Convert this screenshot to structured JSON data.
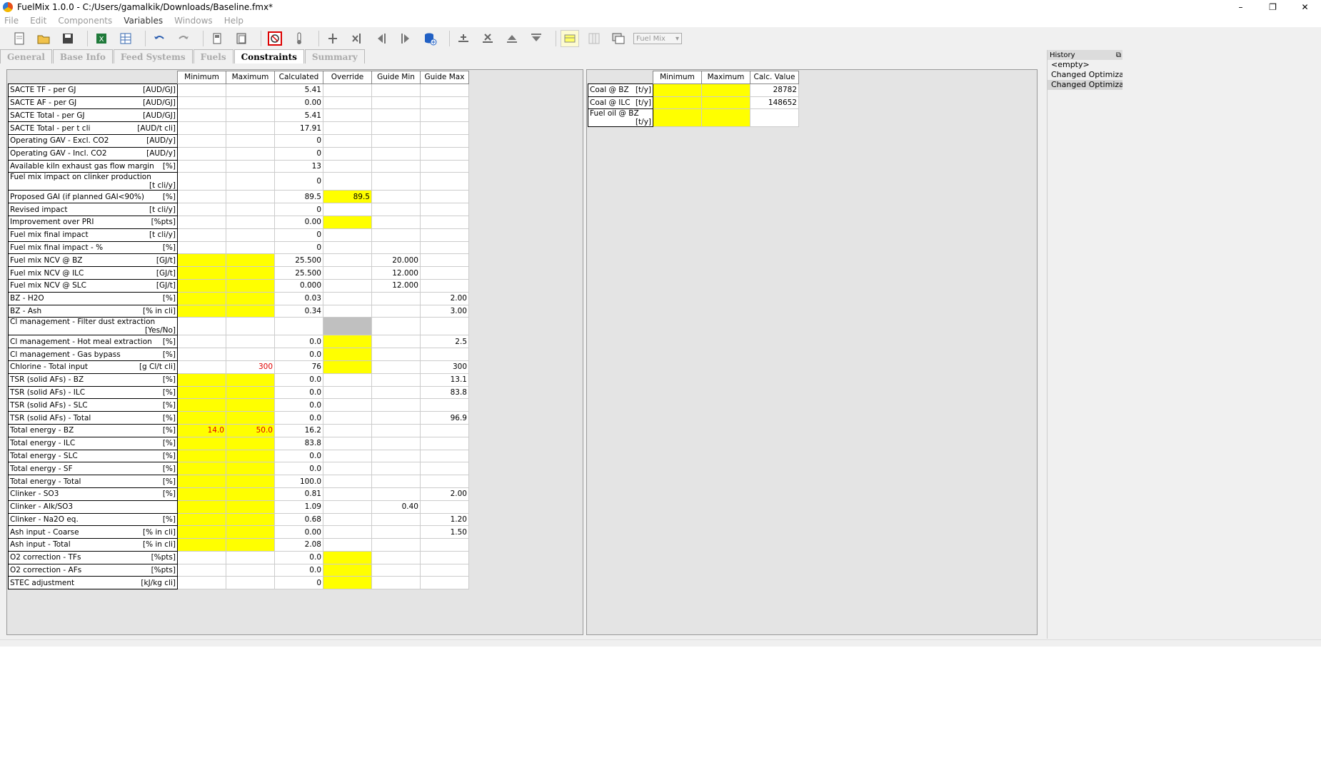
{
  "window": {
    "title": "FuelMix 1.0.0 - C:/Users/gamalkik/Downloads/Baseline.fmx*",
    "minimize": "–",
    "restore": "❐",
    "close": "✕"
  },
  "menu": [
    "File",
    "Edit",
    "Components",
    "Variables",
    "Windows",
    "Help"
  ],
  "toolbar": {
    "combo_value": "Fuel Mix",
    "combo_arrow": "▾"
  },
  "tabs": [
    "General",
    "Base Info",
    "Feed Systems",
    "Fuels",
    "Constraints",
    "Summary"
  ],
  "active_tab": "Constraints",
  "constraints": {
    "headers": [
      "Minimum",
      "Maximum",
      "Calculated",
      "Override",
      "Guide Min",
      "Guide Max"
    ],
    "rows": [
      {
        "name": "SACTE TF - per GJ",
        "unit": "[AUD/GJ]",
        "cells": [
          "",
          "",
          "5.41",
          "",
          "",
          ""
        ],
        "colors": [
          "",
          "",
          "",
          "",
          "",
          ""
        ]
      },
      {
        "name": "SACTE AF - per GJ",
        "unit": "[AUD/GJ]",
        "cells": [
          "",
          "",
          "0.00",
          "",
          "",
          ""
        ],
        "colors": [
          "",
          "",
          "",
          "",
          "",
          ""
        ]
      },
      {
        "name": "SACTE Total - per GJ",
        "unit": "[AUD/GJ]",
        "cells": [
          "",
          "",
          "5.41",
          "",
          "",
          ""
        ],
        "colors": [
          "",
          "",
          "",
          "",
          "",
          ""
        ]
      },
      {
        "name": "SACTE Total - per t cli",
        "unit": "[AUD/t cli]",
        "cells": [
          "",
          "",
          "17.91",
          "",
          "",
          ""
        ],
        "colors": [
          "",
          "",
          "",
          "",
          "",
          ""
        ]
      },
      {
        "name": "Operating GAV - Excl. CO2",
        "unit": "[AUD/y]",
        "cells": [
          "",
          "",
          "0",
          "",
          "",
          ""
        ],
        "colors": [
          "",
          "",
          "",
          "",
          "",
          ""
        ]
      },
      {
        "name": "Operating GAV - Incl. CO2",
        "unit": "[AUD/y]",
        "cells": [
          "",
          "",
          "0",
          "",
          "",
          ""
        ],
        "colors": [
          "",
          "",
          "",
          "",
          "",
          ""
        ]
      },
      {
        "name": "Available kiln exhaust gas flow margin",
        "unit": "[%]",
        "cells": [
          "",
          "",
          "13",
          "",
          "",
          ""
        ],
        "colors": [
          "",
          "",
          "",
          "",
          "",
          ""
        ]
      },
      {
        "name": "Fuel mix impact on clinker production",
        "unit": "[t cli/y]",
        "cells": [
          "",
          "",
          "0",
          "",
          "",
          ""
        ],
        "colors": [
          "",
          "",
          "",
          "",
          "",
          ""
        ]
      },
      {
        "name": "Proposed GAI (if planned GAI<90%)",
        "unit": "[%]",
        "cells": [
          "",
          "",
          "89.5",
          "89.5",
          "",
          ""
        ],
        "colors": [
          "",
          "",
          "",
          "y",
          "",
          ""
        ]
      },
      {
        "name": "Revised impact",
        "unit": "[t cli/y]",
        "cells": [
          "",
          "",
          "0",
          "",
          "",
          ""
        ],
        "colors": [
          "",
          "",
          "",
          "",
          "",
          ""
        ]
      },
      {
        "name": "Improvement over PRI",
        "unit": "[%pts]",
        "cells": [
          "",
          "",
          "0.00",
          "",
          "",
          ""
        ],
        "colors": [
          "",
          "",
          "",
          "y",
          "",
          ""
        ]
      },
      {
        "name": "Fuel mix final impact",
        "unit": "[t cli/y]",
        "cells": [
          "",
          "",
          "0",
          "",
          "",
          ""
        ],
        "colors": [
          "",
          "",
          "",
          "",
          "",
          ""
        ]
      },
      {
        "name": "Fuel mix final impact - %",
        "unit": "[%]",
        "cells": [
          "",
          "",
          "0",
          "",
          "",
          ""
        ],
        "colors": [
          "",
          "",
          "",
          "",
          "",
          ""
        ]
      },
      {
        "name": "Fuel mix NCV @ BZ",
        "unit": "[GJ/t]",
        "cells": [
          "",
          "",
          "25.500",
          "",
          "20.000",
          ""
        ],
        "colors": [
          "y",
          "y",
          "",
          "",
          "",
          ""
        ]
      },
      {
        "name": "Fuel mix NCV @ ILC",
        "unit": "[GJ/t]",
        "cells": [
          "",
          "",
          "25.500",
          "",
          "12.000",
          ""
        ],
        "colors": [
          "y",
          "y",
          "",
          "",
          "",
          ""
        ]
      },
      {
        "name": "Fuel mix NCV @ SLC",
        "unit": "[GJ/t]",
        "cells": [
          "",
          "",
          "0.000",
          "",
          "12.000",
          ""
        ],
        "colors": [
          "y",
          "y",
          "",
          "",
          "",
          ""
        ]
      },
      {
        "name": "BZ - H2O",
        "unit": "[%]",
        "cells": [
          "",
          "",
          "0.03",
          "",
          "",
          "2.00"
        ],
        "colors": [
          "y",
          "y",
          "",
          "",
          "",
          ""
        ]
      },
      {
        "name": "BZ - Ash",
        "unit": "[% in cli]",
        "cells": [
          "",
          "",
          "0.34",
          "",
          "",
          "3.00"
        ],
        "colors": [
          "y",
          "y",
          "",
          "",
          "",
          ""
        ]
      },
      {
        "name": "Cl management - Filter dust extraction",
        "unit": "[Yes/No]",
        "cells": [
          "",
          "",
          "",
          "",
          "",
          ""
        ],
        "colors": [
          "",
          "",
          "",
          "g",
          "",
          ""
        ]
      },
      {
        "name": "Cl management - Hot meal extraction",
        "unit": "[%]",
        "cells": [
          "",
          "",
          "0.0",
          "",
          "",
          "2.5"
        ],
        "colors": [
          "",
          "",
          "",
          "y",
          "",
          ""
        ]
      },
      {
        "name": "Cl management - Gas bypass",
        "unit": "[%]",
        "cells": [
          "",
          "",
          "0.0",
          "",
          "",
          ""
        ],
        "colors": [
          "",
          "",
          "",
          "y",
          "",
          ""
        ]
      },
      {
        "name": "Chlorine - Total input",
        "unit": "[g Cl/t cli]",
        "cells": [
          "",
          "300",
          "76",
          "",
          "",
          "300"
        ],
        "colors": [
          "",
          "r",
          "",
          "y",
          "",
          ""
        ]
      },
      {
        "name": "TSR (solid AFs) - BZ",
        "unit": "[%]",
        "cells": [
          "",
          "",
          "0.0",
          "",
          "",
          "13.1"
        ],
        "colors": [
          "y",
          "y",
          "",
          "",
          "",
          ""
        ]
      },
      {
        "name": "TSR (solid AFs) - ILC",
        "unit": "[%]",
        "cells": [
          "",
          "",
          "0.0",
          "",
          "",
          "83.8"
        ],
        "colors": [
          "y",
          "y",
          "",
          "",
          "",
          ""
        ]
      },
      {
        "name": "TSR (solid AFs) - SLC",
        "unit": "[%]",
        "cells": [
          "",
          "",
          "0.0",
          "",
          "",
          ""
        ],
        "colors": [
          "y",
          "y",
          "",
          "",
          "",
          ""
        ]
      },
      {
        "name": "TSR (solid AFs) - Total",
        "unit": "[%]",
        "cells": [
          "",
          "",
          "0.0",
          "",
          "",
          "96.9"
        ],
        "colors": [
          "y",
          "y",
          "",
          "",
          "",
          ""
        ]
      },
      {
        "name": "Total energy - BZ",
        "unit": "[%]",
        "cells": [
          "14.0",
          "50.0",
          "16.2",
          "",
          "",
          ""
        ],
        "colors": [
          "yr",
          "yr",
          "",
          "",
          "",
          ""
        ]
      },
      {
        "name": "Total energy - ILC",
        "unit": "[%]",
        "cells": [
          "",
          "",
          "83.8",
          "",
          "",
          ""
        ],
        "colors": [
          "y",
          "y",
          "",
          "",
          "",
          ""
        ]
      },
      {
        "name": "Total energy - SLC",
        "unit": "[%]",
        "cells": [
          "",
          "",
          "0.0",
          "",
          "",
          ""
        ],
        "colors": [
          "y",
          "y",
          "",
          "",
          "",
          ""
        ]
      },
      {
        "name": "Total energy - SF",
        "unit": "[%]",
        "cells": [
          "",
          "",
          "0.0",
          "",
          "",
          ""
        ],
        "colors": [
          "y",
          "y",
          "",
          "",
          "",
          ""
        ]
      },
      {
        "name": "Total energy - Total",
        "unit": "[%]",
        "cells": [
          "",
          "",
          "100.0",
          "",
          "",
          ""
        ],
        "colors": [
          "y",
          "y",
          "",
          "",
          "",
          ""
        ]
      },
      {
        "name": "Clinker - SO3",
        "unit": "[%]",
        "cells": [
          "",
          "",
          "0.81",
          "",
          "",
          "2.00"
        ],
        "colors": [
          "y",
          "y",
          "",
          "",
          "",
          ""
        ]
      },
      {
        "name": "Clinker - Alk/SO3",
        "unit": "",
        "cells": [
          "",
          "",
          "1.09",
          "",
          "0.40",
          ""
        ],
        "colors": [
          "y",
          "y",
          "",
          "",
          "",
          ""
        ]
      },
      {
        "name": "Clinker - Na2O eq.",
        "unit": "[%]",
        "cells": [
          "",
          "",
          "0.68",
          "",
          "",
          "1.20"
        ],
        "colors": [
          "y",
          "y",
          "",
          "",
          "",
          ""
        ]
      },
      {
        "name": "Ash input - Coarse",
        "unit": "[% in cli]",
        "cells": [
          "",
          "",
          "0.00",
          "",
          "",
          "1.50"
        ],
        "colors": [
          "y",
          "y",
          "",
          "",
          "",
          ""
        ]
      },
      {
        "name": "Ash input - Total",
        "unit": "[% in cli]",
        "cells": [
          "",
          "",
          "2.08",
          "",
          "",
          ""
        ],
        "colors": [
          "y",
          "y",
          "",
          "",
          "",
          ""
        ]
      },
      {
        "name": "O2 correction - TFs",
        "unit": "[%pts]",
        "cells": [
          "",
          "",
          "0.0",
          "",
          "",
          ""
        ],
        "colors": [
          "",
          "",
          "",
          "y",
          "",
          ""
        ]
      },
      {
        "name": "O2 correction - AFs",
        "unit": "[%pts]",
        "cells": [
          "",
          "",
          "0.0",
          "",
          "",
          ""
        ],
        "colors": [
          "",
          "",
          "",
          "y",
          "",
          ""
        ]
      },
      {
        "name": "STEC adjustment",
        "unit": "[kJ/kg cli]",
        "cells": [
          "",
          "",
          "0",
          "",
          "",
          ""
        ],
        "colors": [
          "",
          "",
          "",
          "y",
          "",
          ""
        ]
      }
    ]
  },
  "fuel_limits": {
    "headers": [
      "Minimum",
      "Maximum",
      "Calc. Value"
    ],
    "rows": [
      {
        "name": "Coal @ BZ",
        "unit": "[t/y]",
        "cells": [
          "",
          "",
          "28782"
        ],
        "colors": [
          "y",
          "y",
          ""
        ]
      },
      {
        "name": "Coal @ ILC",
        "unit": "[t/y]",
        "cells": [
          "",
          "",
          "148652"
        ],
        "colors": [
          "y",
          "y",
          ""
        ]
      },
      {
        "name": "Fuel oil @ BZ",
        "unit": "[t/y]",
        "cells": [
          "",
          "",
          ""
        ],
        "colors": [
          "y",
          "y",
          ""
        ]
      }
    ]
  },
  "history": {
    "title": "History",
    "float_icon": "⧉",
    "close_icon": "✕",
    "items": [
      "<empty>",
      "Changed Optimization",
      "Changed Optimization"
    ]
  }
}
